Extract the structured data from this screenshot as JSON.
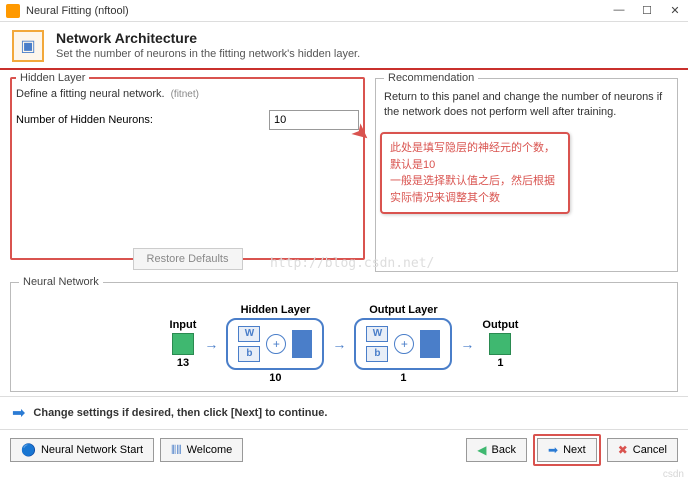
{
  "window": {
    "title": "Neural Fitting (nftool)"
  },
  "header": {
    "title": "Network Architecture",
    "subtitle": "Set the number of neurons in the fitting network's hidden layer."
  },
  "hidden_layer": {
    "legend": "Hidden Layer",
    "desc": "Define a fitting neural network.",
    "fitnet": "(fitnet)",
    "neurons_label": "Number of Hidden Neurons:",
    "neurons_value": "10",
    "restore": "Restore Defaults"
  },
  "recommendation": {
    "legend": "Recommendation",
    "text": "Return to this panel and change the number of neurons if the network does not perform well after training."
  },
  "annotation": "此处是填写隐层的神经元的个数，默认是10\n一般是选择默认值之后，然后根据实际情况来调整其个数",
  "nn": {
    "legend": "Neural Network",
    "input": "Input",
    "hidden": "Hidden Layer",
    "output_layer": "Output Layer",
    "output": "Output",
    "input_n": "13",
    "hidden_n": "10",
    "out_n": "1",
    "out_final": "1",
    "W": "W",
    "b": "b"
  },
  "hint": "Change settings  if desired, then click [Next] to continue.",
  "buttons": {
    "nnstart": "Neural Network Start",
    "welcome": "Welcome",
    "back": "Back",
    "next": "Next",
    "cancel": "Cancel"
  },
  "watermark": "http://blog.csdn.net/"
}
